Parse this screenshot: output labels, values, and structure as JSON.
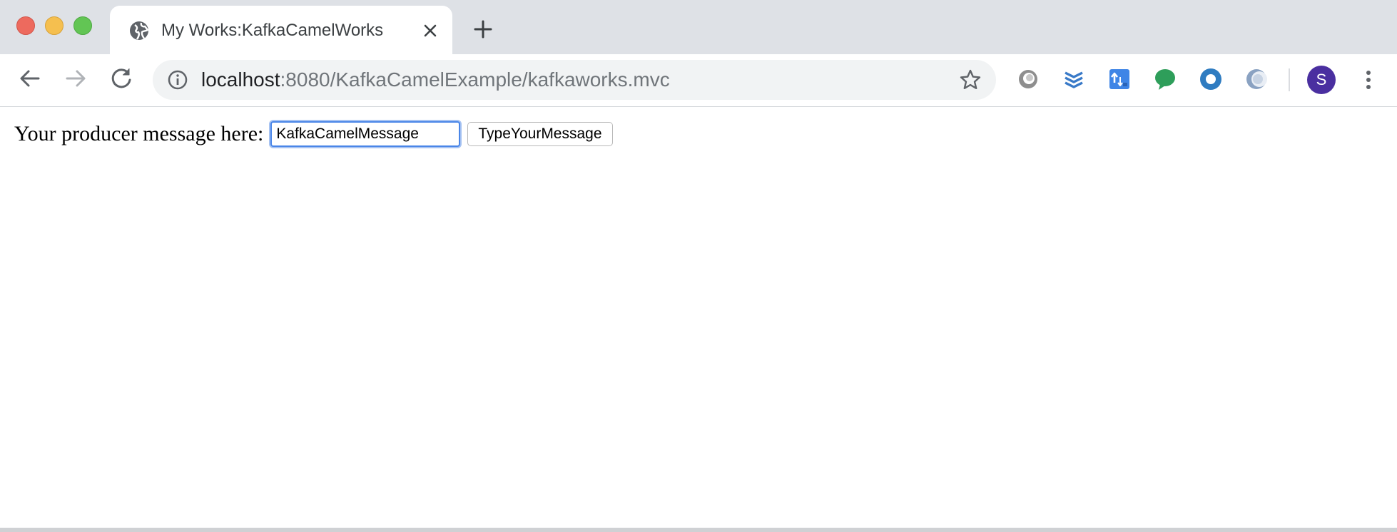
{
  "browser": {
    "tab": {
      "title": "My Works:KafkaCamelWorks",
      "favicon": "globe-icon"
    },
    "address_bar": {
      "host": "localhost",
      "path": ":8080/KafkaCamelExample/kafkaworks.mvc"
    },
    "profile_initial": "S",
    "extensions": [
      "ext-circle-gray-icon",
      "ext-layers-blue-icon",
      "ext-translate-blue-icon",
      "ext-chat-green-icon",
      "ext-ring-blue-icon",
      "ext-crescent-icon"
    ]
  },
  "page": {
    "label": "Your producer message here:",
    "input_value": "KafkaCamelMessage",
    "button_label": "TypeYourMessage"
  },
  "colors": {
    "tabstrip_bg": "#dee1e6",
    "omnibox_bg": "#f1f3f4",
    "avatar_bg": "#4a2fa0",
    "focus_ring": "#4a86e8"
  }
}
